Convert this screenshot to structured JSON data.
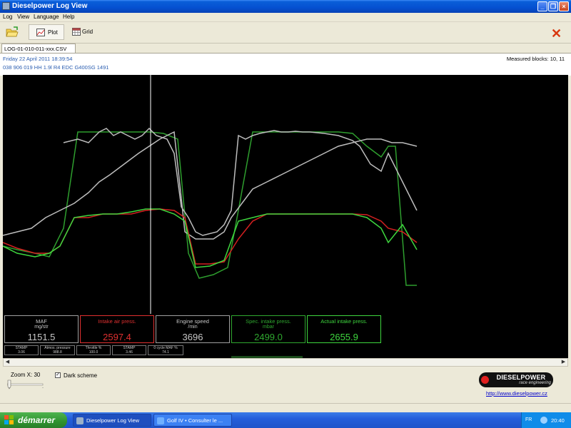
{
  "window": {
    "title": "Dieselpower Log View"
  },
  "menu": [
    "Log",
    "View",
    "Language",
    "Help"
  ],
  "toolbar": {
    "plot_label": "Plot",
    "grid_label": "Grid"
  },
  "file_tab": "LOG-01-010-011-xxx.CSV",
  "info": {
    "date": "Friday 22 April 2011 18:39:54",
    "ecu": "038 906 019 HH  1.9l R4 EDC G400SG  1491",
    "blocks": "Measured blocks: 10, 11"
  },
  "gauges": [
    {
      "name": "MAF",
      "unit": "mg/str",
      "value": "1151.5",
      "color": "#c8c8c8",
      "border": "#a0a0a0"
    },
    {
      "name": "Intake air press.",
      "unit": "",
      "value": "2597.4",
      "color": "#e03030",
      "border": "#e03030"
    },
    {
      "name": "Engine speed",
      "unit": "/min",
      "value": "3696",
      "color": "#c8c8c8",
      "border": "#a0a0a0"
    },
    {
      "name": "Spec. intake press.",
      "unit": "mbar",
      "value": "2499.0",
      "color": "#2fa82f",
      "border": "#2fa82f"
    },
    {
      "name": "Actual intake press.",
      "unit": "",
      "value": "2655.9",
      "color": "#3ed63e",
      "border": "#3ed63e"
    }
  ],
  "mini_gauges": [
    {
      "name": "STAMP",
      "value": "3.06"
    },
    {
      "name": "Atmos. pressure",
      "value": "988.8"
    },
    {
      "name": "Throttle %",
      "value": "100.0"
    },
    {
      "name": "STAMP",
      "value": "3.46"
    },
    {
      "name": "0 cycle MAF %",
      "value": "74.1"
    }
  ],
  "chart_data": {
    "type": "line",
    "title": "",
    "xlabel": "",
    "ylabel": "",
    "grid": false,
    "background": "#000000",
    "cursor_x": 207,
    "series": [
      {
        "color": "#2e9e2e",
        "x": [
          0,
          20,
          45,
          65,
          85,
          105,
          125,
          145,
          165,
          185,
          205,
          225,
          245,
          260,
          275,
          295,
          315,
          330,
          350,
          370,
          390,
          410,
          430,
          450,
          470,
          490,
          510,
          530,
          540,
          550,
          565,
          580
        ],
        "y": [
          240,
          245,
          250,
          255,
          215,
          80,
          80,
          80,
          80,
          80,
          80,
          82,
          90,
          250,
          285,
          280,
          270,
          190,
          80,
          80,
          80,
          80,
          80,
          80,
          80,
          82,
          100,
          115,
          100,
          100,
          295,
          295
        ]
      },
      {
        "color": "#bdbdbd",
        "x": [
          0,
          40,
          60,
          80,
          100,
          120,
          135,
          150,
          170,
          190,
          205,
          220,
          240,
          255,
          270,
          295,
          310,
          320,
          335,
          350,
          370,
          390,
          410,
          430,
          450,
          470,
          490,
          510,
          530,
          545,
          560,
          580
        ],
        "y": [
          225,
          215,
          200,
          190,
          180,
          165,
          150,
          140,
          125,
          110,
          100,
          90,
          80,
          220,
          230,
          230,
          220,
          200,
          180,
          160,
          150,
          140,
          130,
          120,
          110,
          100,
          95,
          90,
          90,
          95,
          95,
          100
        ]
      },
      {
        "color": "#bdbdbd",
        "x": [
          85,
          105,
          120,
          135,
          145,
          155,
          165,
          175,
          185,
          195,
          205,
          215,
          230,
          240,
          250,
          260,
          270,
          280,
          300,
          310,
          320,
          330,
          340,
          350,
          360,
          370,
          380,
          390,
          400,
          410,
          420,
          430,
          450,
          470,
          490,
          500,
          515,
          530,
          540,
          560,
          580
        ],
        "y": [
          95,
          90,
          95,
          80,
          75,
          85,
          80,
          85,
          90,
          85,
          75,
          85,
          90,
          110,
          185,
          200,
          220,
          225,
          220,
          210,
          190,
          85,
          90,
          85,
          82,
          80,
          78,
          80,
          80,
          79,
          80,
          80,
          82,
          85,
          92,
          100,
          125,
          135,
          110,
          150,
          190
        ]
      },
      {
        "color": "#d42020",
        "x": [
          0,
          20,
          45,
          65,
          80,
          100,
          120,
          140,
          160,
          180,
          200,
          220,
          240,
          255,
          270,
          290,
          310,
          330,
          350,
          370,
          390,
          410,
          430,
          450,
          470,
          490,
          510,
          530,
          540,
          560,
          580
        ],
        "y": [
          235,
          243,
          250,
          250,
          240,
          200,
          200,
          195,
          195,
          195,
          190,
          188,
          190,
          200,
          265,
          265,
          262,
          230,
          205,
          195,
          195,
          195,
          195,
          195,
          195,
          195,
          196,
          205,
          215,
          220,
          235
        ]
      },
      {
        "color": "#3ed63e",
        "x": [
          0,
          20,
          45,
          65,
          80,
          100,
          120,
          140,
          160,
          180,
          200,
          220,
          240,
          255,
          270,
          290,
          310,
          330,
          350,
          370,
          390,
          410,
          430,
          450,
          470,
          490,
          510,
          530,
          540,
          560,
          580
        ],
        "y": [
          240,
          250,
          255,
          250,
          240,
          200,
          197,
          195,
          195,
          192,
          188,
          188,
          195,
          205,
          270,
          268,
          260,
          205,
          200,
          195,
          195,
          195,
          195,
          195,
          195,
          195,
          200,
          215,
          235,
          210,
          245
        ]
      }
    ]
  },
  "controls": {
    "zoom_label": "Zoom X: 30",
    "dark_scheme_label": "Dark scheme",
    "dark_scheme_checked": "✓"
  },
  "logo": {
    "name": "DIESELPOWER",
    "subtitle": "race engineering",
    "url": "http://www.dieselpower.cz"
  },
  "taskbar": {
    "start": "démarrer",
    "tasks": [
      {
        "label": "Dieselpower Log View",
        "active": true
      },
      {
        "label": "Golf IV • Consulter le ...",
        "active": false
      }
    ],
    "lang": "FR",
    "clock": "20:40"
  }
}
